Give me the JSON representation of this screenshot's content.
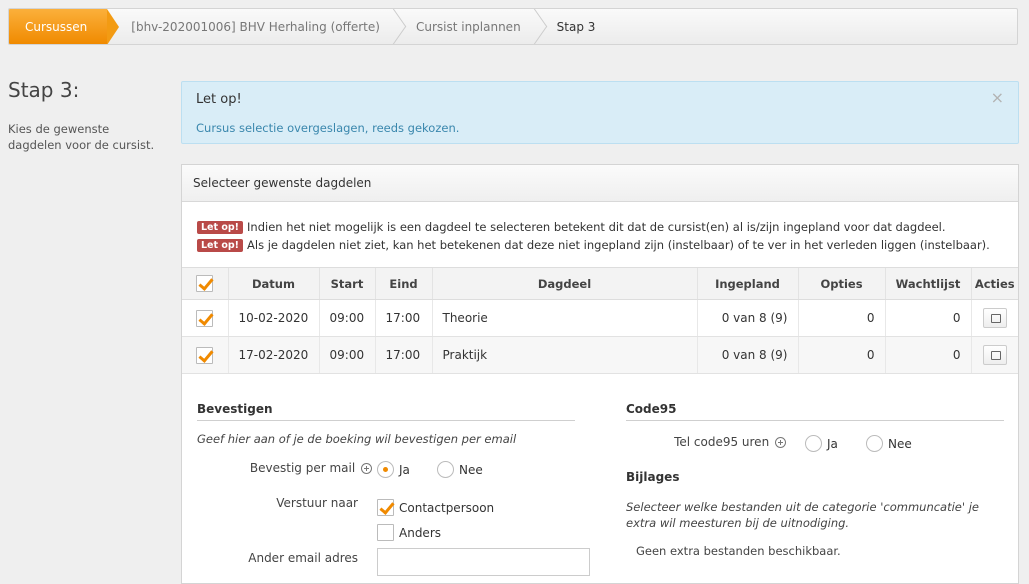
{
  "breadcrumb": {
    "items": [
      "Cursussen",
      "[bhv-202001006] BHV Herhaling (offerte)",
      "Cursist inplannen",
      "Stap 3"
    ]
  },
  "side": {
    "title": "Stap 3:",
    "description": "Kies de gewenste dagdelen voor de cursist."
  },
  "alert": {
    "title": "Let op!",
    "text": "Cursus selectie overgeslagen, reeds gekozen.",
    "close": "×"
  },
  "panel": {
    "title": "Selecteer gewenste dagdelen",
    "notes": [
      {
        "badge": "Let op!",
        "text": "Indien het niet mogelijk is een dagdeel te selecteren betekent dit dat de cursist(en) al is/zijn ingepland voor dat dagdeel."
      },
      {
        "badge": "Let op!",
        "text": "Als je dagdelen niet ziet, kan het betekenen dat deze niet ingepland zijn (instelbaar) of te ver in het verleden liggen (instelbaar)."
      }
    ],
    "columns": [
      "Datum",
      "Start",
      "Eind",
      "Dagdeel",
      "Ingepland",
      "Opties",
      "Wachtlijst",
      "Acties"
    ],
    "rows": [
      {
        "checked": true,
        "datum": "10-02-2020",
        "start": "09:00",
        "eind": "17:00",
        "dagdeel": "Theorie",
        "ingepland": "0 van 8 (9)",
        "opties": "0",
        "wachtlijst": "0"
      },
      {
        "checked": true,
        "datum": "17-02-2020",
        "start": "09:00",
        "eind": "17:00",
        "dagdeel": "Praktijk",
        "ingepland": "0 van 8 (9)",
        "opties": "0",
        "wachtlijst": "0"
      }
    ]
  },
  "bevestigen": {
    "title": "Bevestigen",
    "hint": "Geef hier aan of je de boeking wil bevestigen per email",
    "mail_label": "Bevestig per mail",
    "ja": "Ja",
    "nee": "Nee",
    "selected": "Ja",
    "verstuur_label": "Verstuur naar",
    "contactpersoon": "Contactpersoon",
    "anders": "Anders",
    "email_label": "Ander email adres",
    "email_value": ""
  },
  "code95": {
    "title": "Code95",
    "label": "Tel code95 uren",
    "ja": "Ja",
    "nee": "Nee"
  },
  "bijlages": {
    "title": "Bijlages",
    "hint": "Selecteer welke bestanden uit de categorie 'communcatie' je extra wil meesturen bij de uitnodiging.",
    "empty": "Geen extra bestanden beschikbaar."
  },
  "colors": {
    "accent": "#f08a00",
    "alert_bg": "#d9edf7",
    "alert_text": "#3a87ad",
    "badge": "#b94a48"
  }
}
